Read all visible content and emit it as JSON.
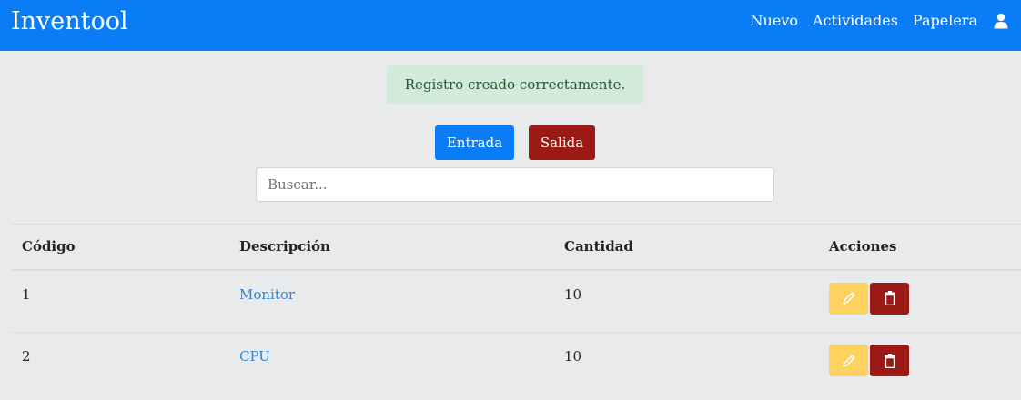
{
  "navbar": {
    "brand": "Inventool",
    "links": [
      "Nuevo",
      "Actividades",
      "Papelera"
    ],
    "user_icon": "user-icon"
  },
  "alert": {
    "message": "Registro creado correctamente."
  },
  "buttons": {
    "entrada": "Entrada",
    "salida": "Salida"
  },
  "search": {
    "placeholder": "Buscar...",
    "value": ""
  },
  "table": {
    "headers": [
      "Código",
      "Descripción",
      "Cantidad",
      "Acciones"
    ],
    "rows": [
      {
        "codigo": "1",
        "descripcion": "Monitor",
        "cantidad": "10"
      },
      {
        "codigo": "2",
        "descripcion": "CPU",
        "cantidad": "10"
      }
    ],
    "action_icons": [
      "pencil-icon",
      "trash-icon"
    ]
  },
  "colors": {
    "navbar": "#0a7cf6",
    "alert_bg": "#d2ead9",
    "entrada": "#0a7cf6",
    "salida": "#9b1a15",
    "edit": "#fdd25e",
    "delete": "#9b1a15",
    "link": "#2b83e4"
  }
}
